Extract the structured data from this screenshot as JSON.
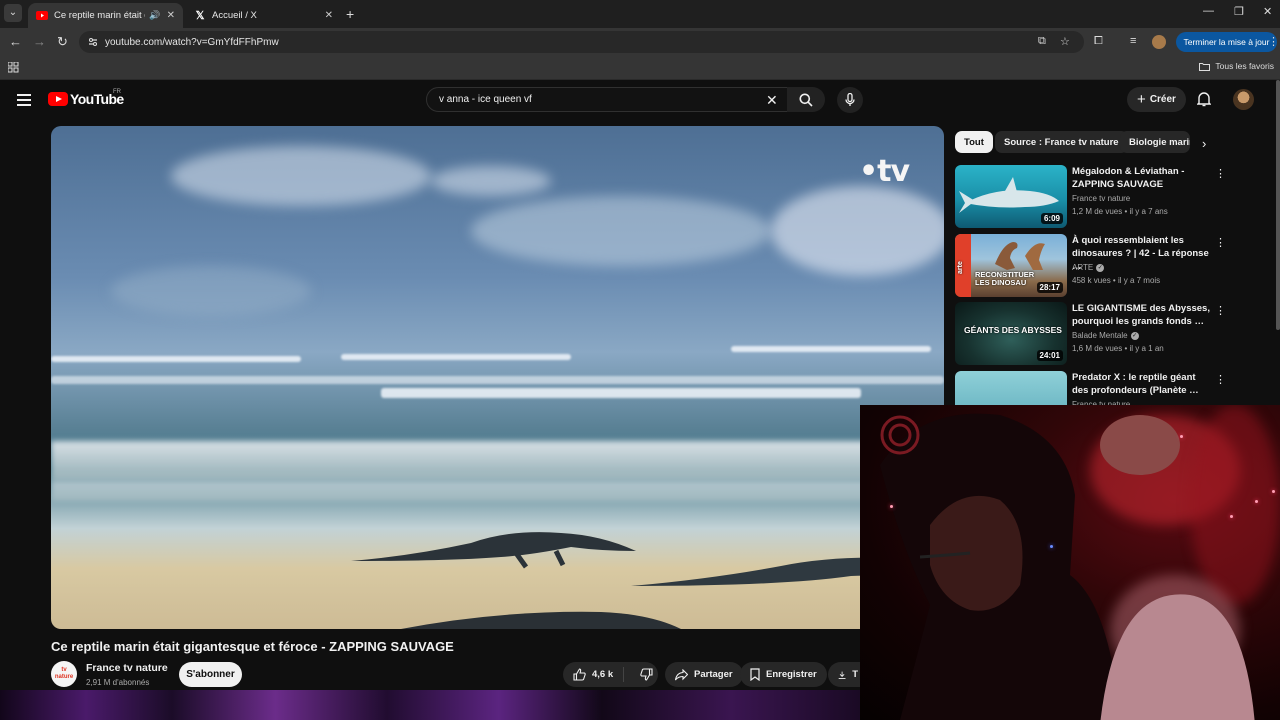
{
  "browser": {
    "tabs": [
      {
        "title": "Ce reptile marin était gigantesque et féroce - ZAPPING SAUVAGE",
        "active": true,
        "audio": true
      },
      {
        "title": "Accueil / X",
        "active": false
      }
    ],
    "url": "youtube.com/watch?v=GmYfdFFhPmw",
    "update_button": "Terminer la mise à jour",
    "bookmarks_folder": "Tous les favoris"
  },
  "youtube": {
    "logo_text": "YouTube",
    "country_code": "FR",
    "search_value": "v anna - ice queen vf",
    "create_label": "Créer"
  },
  "player": {
    "watermark": "•tv"
  },
  "video": {
    "title": "Ce reptile marin était gigantesque et féroce - ZAPPING SAUVAGE",
    "channel_name": "France tv nature",
    "channel_avatar_text": "tv nature",
    "subscribers": "2,91 M d'abonnés",
    "subscribe_label": "S'abonner",
    "likes": "4,6 k",
    "share_label": "Partager",
    "save_label": "Enregistrer",
    "download_label_partial": "T"
  },
  "chips": [
    {
      "label": "Tout",
      "active": true
    },
    {
      "label": "Source : France tv nature",
      "active": false
    },
    {
      "label": "Biologie marin",
      "active": false
    }
  ],
  "recommendations": [
    {
      "title": "Mégalodon & Léviathan - ZAPPING SAUVAGE",
      "channel": "France tv nature",
      "verified": false,
      "meta": "1,2 M de vues • il y a 7 ans",
      "duration": "6:09",
      "thumb_text": "",
      "thumb_badge": ""
    },
    {
      "title": "À quoi ressemblaient les dinosaures ? | 42 - La réponse …",
      "channel": "ARTE",
      "verified": true,
      "meta": "458 k vues • il y a 7 mois",
      "duration": "28:17",
      "thumb_text": "RECONSTITUER LES DINOSAU",
      "thumb_badge": "arte"
    },
    {
      "title": "LE GIGANTISME des Abysses, pourquoi les grands fonds …",
      "channel": "Balade Mentale",
      "verified": true,
      "meta": "1,6 M de vues • il y a 1 an",
      "duration": "24:01",
      "thumb_text": "GÉANTS DES ABYSSES",
      "thumb_badge": ""
    },
    {
      "title": "Predator X : le reptile géant des profondeurs (Planète …",
      "channel": "France tv nature",
      "verified": false,
      "meta": "",
      "duration": "",
      "thumb_text": "",
      "thumb_badge": ""
    }
  ],
  "icons": {
    "back": "arrow-left-icon",
    "forward": "arrow-right-icon",
    "reload": "reload-icon",
    "search": "search-icon",
    "mic": "mic-icon",
    "bell": "bell-icon",
    "like": "thumbs-up-icon",
    "dislike": "thumbs-down-icon",
    "share": "share-icon",
    "save": "bookmark-icon",
    "download": "download-icon"
  }
}
